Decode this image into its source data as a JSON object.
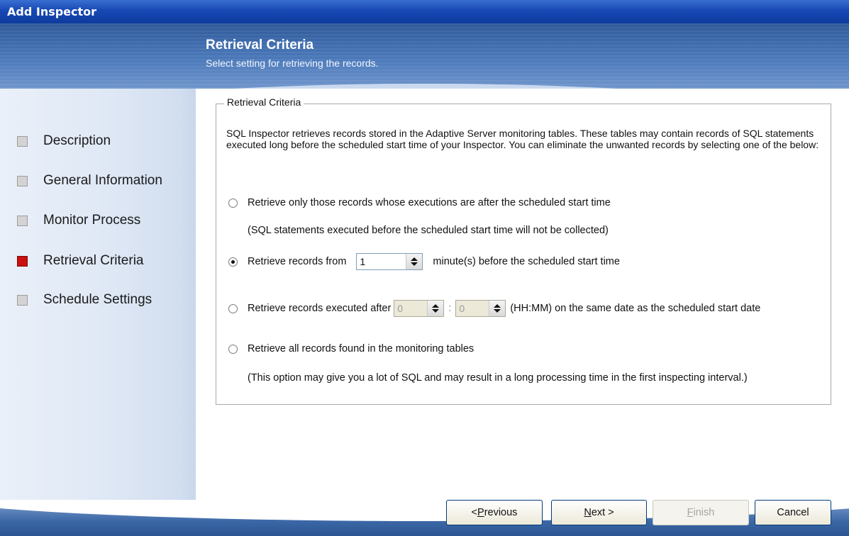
{
  "window": {
    "title": "Add Inspector"
  },
  "header": {
    "title": "Retrieval Criteria",
    "subtitle": "Select setting for retrieving the records."
  },
  "sidebar": {
    "items": [
      {
        "label": "Description",
        "active": false
      },
      {
        "label": "General Information",
        "active": false
      },
      {
        "label": "Monitor Process",
        "active": false
      },
      {
        "label": "Retrieval Criteria",
        "active": true
      },
      {
        "label": "Schedule Settings",
        "active": false
      }
    ],
    "active_color": "#cc0f0f"
  },
  "group": {
    "legend": "Retrieval Criteria",
    "description": "SQL Inspector retrieves records stored in the Adaptive Server monitoring tables. These tables may contain records of SQL statements executed long before the scheduled start time of your Inspector. You can eliminate the unwanted records by selecting one of the below:",
    "option1": {
      "label": "Retrieve only those records whose executions are after the scheduled start time",
      "note": "(SQL statements executed before the scheduled start time will not be collected)",
      "selected": false
    },
    "option2": {
      "label": "Retrieve records from",
      "minutes_value": "1",
      "suffix": "minute(s) before the scheduled start time",
      "selected": true
    },
    "option3": {
      "label": "Retrieve records executed after",
      "hours_value": "0",
      "separator": ":",
      "minutes_value": "0",
      "suffix": "(HH:MM) on the same date as the scheduled start date",
      "selected": false
    },
    "option4": {
      "label": "Retrieve all records found in the monitoring tables",
      "note": "(This option may give you a lot of SQL and may result in a long processing time in the first inspecting interval.)",
      "selected": false
    }
  },
  "buttons": {
    "previous_prefix": "< ",
    "previous_mnemonic": "P",
    "previous_rest": "revious",
    "next_mnemonic": "N",
    "next_rest": "ext >",
    "finish_mnemonic": "F",
    "finish_rest": "inish",
    "cancel": "Cancel"
  }
}
